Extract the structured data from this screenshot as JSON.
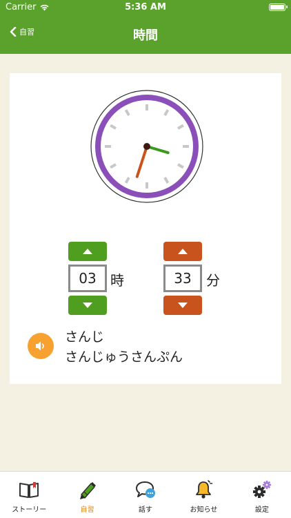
{
  "status_bar": {
    "carrier": "Carrier",
    "time": "5:36 AM"
  },
  "nav": {
    "back_label": "自習",
    "title": "時間"
  },
  "clock": {
    "hour": 3,
    "minute": 33,
    "face_color": "#8a4fb8",
    "hour_hand_color": "#3a9a1c",
    "minute_hand_color": "#c8531c"
  },
  "time_picker": {
    "hour": {
      "value": "03",
      "unit": "時"
    },
    "minute": {
      "value": "33",
      "unit": "分"
    }
  },
  "reading": {
    "hour_text": "さんじ",
    "minute_text": "さんじゅうさんぷん"
  },
  "tabs": [
    {
      "label": "ストーリー",
      "icon": "book-icon"
    },
    {
      "label": "自習",
      "icon": "pencil-icon",
      "active": true
    },
    {
      "label": "話す",
      "icon": "chat-icon"
    },
    {
      "label": "お知らせ",
      "icon": "bell-icon"
    },
    {
      "label": "設定",
      "icon": "gear-icon"
    }
  ],
  "colors": {
    "accent_green": "#5aa22c",
    "accent_orange": "#c8531c",
    "active_tab": "#e08a1e",
    "speaker": "#f7a130"
  }
}
